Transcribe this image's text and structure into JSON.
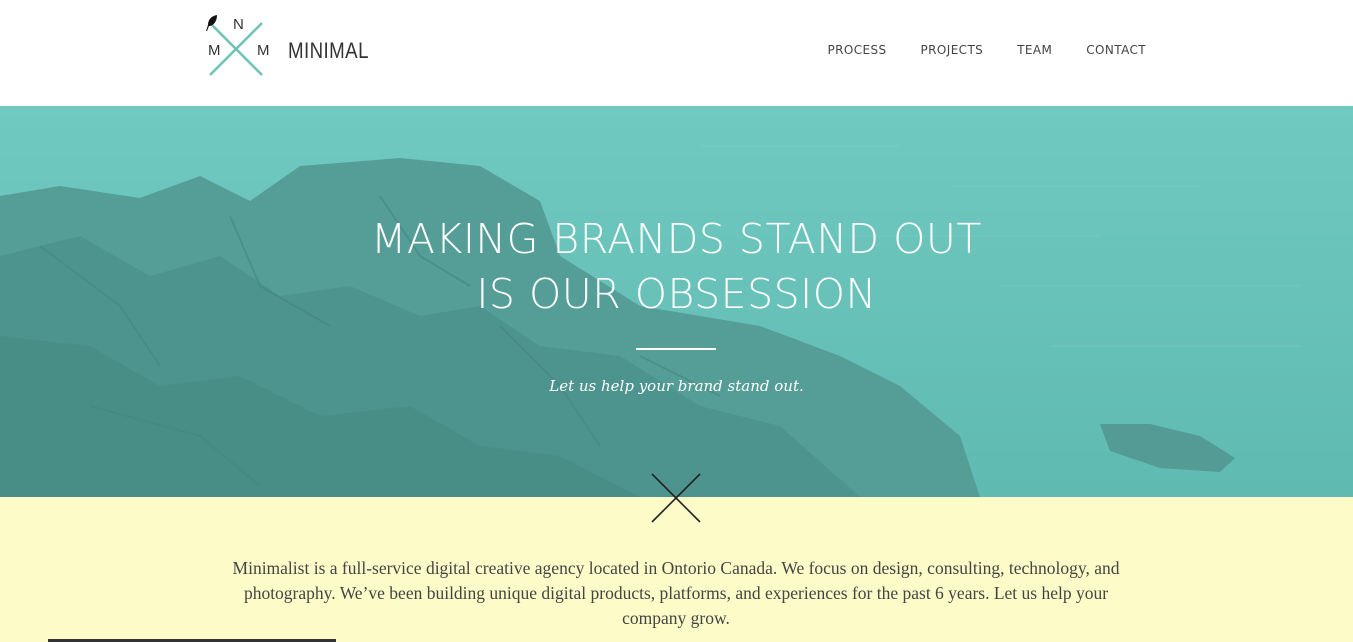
{
  "brand": {
    "logo_letters": {
      "top": "N",
      "left": "M",
      "right": "M"
    },
    "name": "MINIMAL",
    "accent_color": "#6fc1b6"
  },
  "nav": {
    "items": [
      {
        "label": "PROCESS"
      },
      {
        "label": "PROJECTS"
      },
      {
        "label": "TEAM"
      },
      {
        "label": "CONTACT"
      }
    ]
  },
  "hero": {
    "title_line1": "MAKING BRANDS STAND OUT",
    "title_line2": "IS OUR OBSESSION",
    "tagline": "Let us help your brand stand out.",
    "overlay_color": "#60c4ba"
  },
  "about": {
    "text": "Minimalist is a full-service digital creative agency located in Ontorio Canada. We focus on design, consulting, technology, and photography. We’ve been building unique digital products, platforms, and experiences for the past 6 years. Let us help your company grow.",
    "background_color": "#fdfcc8"
  },
  "icons": {
    "logo": "crossed-lines-logo-icon",
    "feather": "feather-icon",
    "divider_cross": "cross-icon"
  }
}
